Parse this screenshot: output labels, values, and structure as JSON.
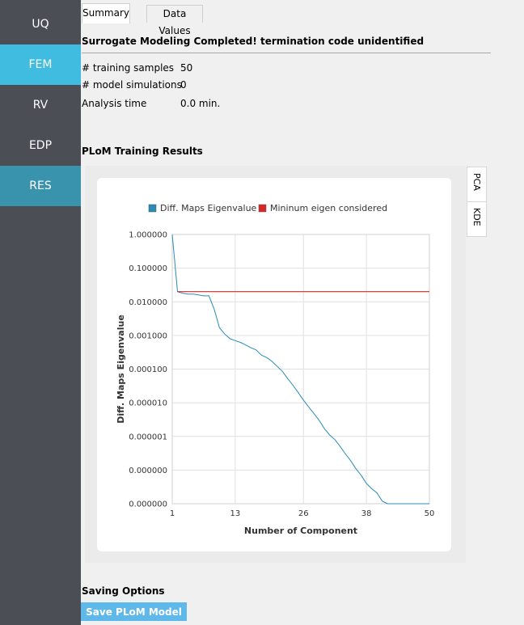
{
  "sidebar": {
    "items": [
      {
        "label": "UQ"
      },
      {
        "label": "FEM"
      },
      {
        "label": "RV"
      },
      {
        "label": "EDP"
      },
      {
        "label": "RES"
      }
    ]
  },
  "tabs": [
    {
      "label": "Summary",
      "active": true
    },
    {
      "label": "Data Values",
      "active": false
    }
  ],
  "summary": {
    "heading": "Surrogate Modeling Completed! termination code unidentified",
    "rows": [
      {
        "label": "# training samples",
        "value": "50"
      },
      {
        "label": "# model simulations",
        "value": "0"
      },
      {
        "label": "Analysis time",
        "value": "0.0 min."
      }
    ]
  },
  "plom": {
    "title": "PLoM Training Results",
    "side_tabs": [
      "PCA",
      "KDE"
    ]
  },
  "chart_data": {
    "type": "line",
    "xlabel": "Number of Component",
    "ylabel": "Diff. Maps Eigenvalue",
    "xlim": [
      1,
      50
    ],
    "ylim": [
      1e-08,
      1
    ],
    "yscale": "log",
    "x_ticks": [
      "1",
      "13",
      "26",
      "38",
      "50"
    ],
    "y_ticks": [
      "1.000000",
      "0.100000",
      "0.010000",
      "0.001000",
      "0.000100",
      "0.000010",
      "0.000001",
      "0.000000",
      "0.000000"
    ],
    "grid": true,
    "legend_position": "top",
    "series": [
      {
        "name": "Diff. Maps Eigenvalue",
        "color": "#2a8bb8",
        "x": [
          1,
          2,
          3,
          4,
          5,
          6,
          7,
          8,
          9,
          10,
          11,
          12,
          13,
          14,
          15,
          16,
          17,
          18,
          19,
          20,
          21,
          22,
          23,
          24,
          25,
          26,
          27,
          28,
          29,
          30,
          31,
          32,
          33,
          34,
          35,
          36,
          37,
          38,
          39,
          40,
          41,
          42,
          43,
          44,
          45,
          46,
          47,
          48,
          49,
          50
        ],
        "y": [
          1.0,
          0.02,
          0.018,
          0.017,
          0.017,
          0.016,
          0.015,
          0.015,
          0.006,
          0.0017,
          0.0011,
          0.0008,
          0.0007,
          0.00062,
          0.00052,
          0.00043,
          0.00037,
          0.00026,
          0.00022,
          0.00017,
          0.00012,
          8.5e-05,
          5.2e-05,
          3.3e-05,
          2e-05,
          1.2e-05,
          7.5e-06,
          4.8e-06,
          3e-06,
          1.7e-06,
          1.1e-06,
          8e-07,
          5e-07,
          3e-07,
          1.9e-07,
          1.1e-07,
          7e-08,
          4e-08,
          2.8e-08,
          2.1e-08,
          1.2e-08,
          7e-09,
          4e-09,
          2.5e-09,
          2.2e-09,
          1.3e-09,
          7e-10,
          4.5e-10,
          2e-10,
          2e-11
        ]
      },
      {
        "name": "Mininum eigen considered",
        "color": "#d62828",
        "x": [
          2,
          50
        ],
        "y": [
          0.02,
          0.02
        ]
      }
    ]
  },
  "saving": {
    "title": "Saving Options",
    "button_label": "Save PLoM Model"
  },
  "colors": {
    "sidebar_bg": "#4b4e55",
    "sidebar_active": "#40bce0",
    "sidebar_res": "#3a93ad",
    "button_bg": "#5fb8ea"
  }
}
